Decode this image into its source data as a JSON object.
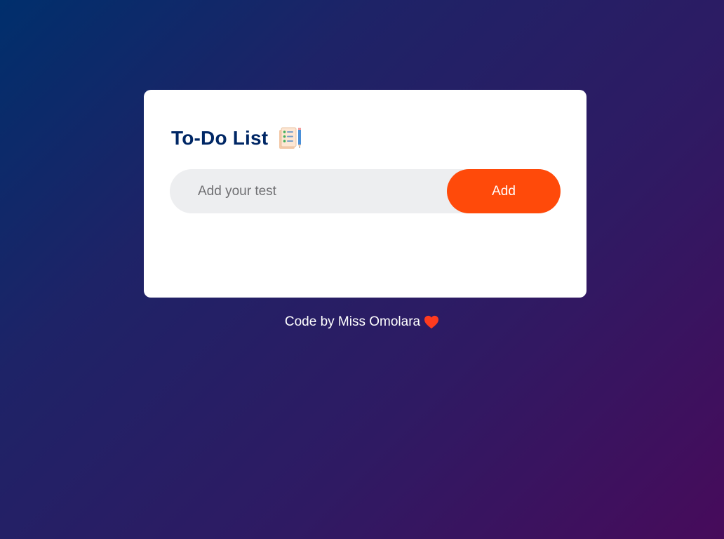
{
  "app": {
    "title": "To-Do List",
    "title_icon": "checklist-pencil-icon"
  },
  "task_input": {
    "placeholder": "Add your test",
    "value": ""
  },
  "add_button": {
    "label": "Add"
  },
  "footer": {
    "credit": "Code by Miss Omolara",
    "heart_icon": "heart-icon"
  },
  "colors": {
    "accent": "#ff4a0a",
    "title": "#002765",
    "input_bg": "#edeef0",
    "card_bg": "#ffffff",
    "bg_start": "#002f6c",
    "bg_end": "#470b5b",
    "heart": "#ff3b1f"
  }
}
